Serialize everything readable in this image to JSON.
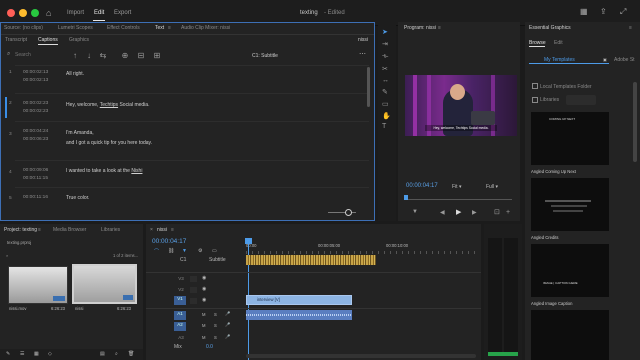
{
  "app": {
    "menu": {
      "import": "Import",
      "edit": "Edit",
      "export": "Export"
    },
    "doc_title": "texting",
    "doc_status": "- Edited"
  },
  "captions_panel": {
    "top_tabs": [
      "Source: (no clips)",
      "Lumetri Scopes",
      "Effect Controls",
      "Text",
      "Audio Clip Mixer: nissi"
    ],
    "subtabs": [
      "Transcript",
      "Captions",
      "Graphics"
    ],
    "sequence_name": "nissi",
    "search_placeholder": "Search",
    "track_label": "C1: Subtitle",
    "captions": [
      {
        "index": "1",
        "in": "00:00:02:13",
        "out": "00:00:02:13",
        "text": [
          "All right."
        ]
      },
      {
        "index": "2",
        "in": "00:00:02:23",
        "out": "00:00:02:23",
        "text": [
          "Hey, welcome, ",
          "Techtips",
          " Social media."
        ]
      },
      {
        "index": "3",
        "in": "00:00:04:24",
        "out": "00:00:06:23",
        "text": [
          "I'm Amanda,",
          "and I got a quick tip for you here today."
        ]
      },
      {
        "index": "4",
        "in": "00:00:09:06",
        "out": "00:00:11:15",
        "text": [
          "I wanted to take a look at the ",
          "Nishi"
        ]
      },
      {
        "index": "5",
        "in": "00:00:11:16",
        "out": "",
        "text": [
          "True color."
        ]
      }
    ]
  },
  "program_monitor": {
    "title": "Program: nissi",
    "timecode": "00:00:04:17",
    "fit": "Fit",
    "quality": "Full",
    "subtitle_overlay": "Hey, welcome, Techtips Social media."
  },
  "essential_graphics": {
    "title": "Essential Graphics",
    "tabs": [
      "Browse",
      "Edit"
    ],
    "my_templates": "My Templates",
    "adobe_stock": "Adobe St",
    "local_templates": "Local Templates Folder",
    "libraries": "Libraries",
    "templates": [
      {
        "label": "Angled Coming Up Next",
        "thumb_text": "COMING UP NEXT"
      },
      {
        "label": "Angled Credits",
        "thumb_text": ""
      },
      {
        "label": "Angled Image Caption",
        "thumb_text": "IMAGE | CAPTION HERE"
      },
      {
        "label": "",
        "thumb_text": ""
      }
    ]
  },
  "project_panel": {
    "tabs": [
      "Project: texting",
      "Media Browser",
      "Libraries"
    ],
    "project_file": "texting.prproj",
    "items_count": "1 of 2 items...",
    "media": [
      {
        "name": "nissi.mov",
        "duration": "6:26:23"
      },
      {
        "name": "nissi",
        "duration": "6:26:23"
      }
    ]
  },
  "timeline": {
    "tab": "nissi",
    "timecode": "00:00:04:17",
    "ruler": [
      "00:00",
      "00:00:05:00",
      "00:00:10:00"
    ],
    "tracks": {
      "caption_label": "C1",
      "caption_name": "Subtitle",
      "video": [
        "V3",
        "V2",
        "V1"
      ],
      "audio": [
        "A1",
        "A2",
        "A3"
      ],
      "mix_label": "Mix",
      "mix_value": "0.0"
    },
    "clip_label": "interview [V]"
  }
}
